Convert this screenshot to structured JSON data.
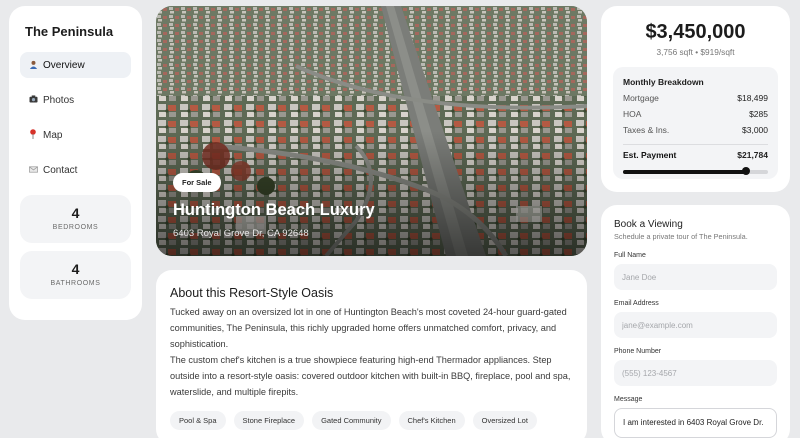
{
  "sidebar": {
    "brand": "The Peninsula",
    "nav": [
      {
        "label": "Overview",
        "icon": "person-icon"
      },
      {
        "label": "Photos",
        "icon": "camera-icon"
      },
      {
        "label": "Map",
        "icon": "pin-icon"
      },
      {
        "label": "Contact",
        "icon": "mail-icon"
      }
    ],
    "stats": [
      {
        "value": "4",
        "label": "BEDROOMS"
      },
      {
        "value": "4",
        "label": "BATHROOMS"
      }
    ]
  },
  "hero": {
    "badge": "For Sale",
    "title": "Huntington Beach Luxury",
    "address": "6403 Royal Grove Dr, CA 92648"
  },
  "about": {
    "title": "About this Resort-Style Oasis",
    "paragraphs": [
      "Tucked away on an oversized lot in one of Huntington Beach's most coveted 24-hour guard-gated communities, The Peninsula, this richly upgraded home offers unmatched comfort, privacy, and sophistication.",
      "The custom chef's kitchen is a true showpiece featuring high-end Thermador appliances. Step outside into a resort-style oasis: covered outdoor kitchen with built-in BBQ, fireplace, pool and spa, waterslide, and multiple firepits."
    ],
    "tags": [
      "Pool & Spa",
      "Stone Fireplace",
      "Gated Community",
      "Chef's Kitchen",
      "Oversized Lot"
    ]
  },
  "price": {
    "amount": "$3,450,000",
    "sub": "3,756 sqft • $919/sqft",
    "breakdown": {
      "title": "Monthly Breakdown",
      "rows": [
        {
          "label": "Mortgage",
          "value": "$18,499"
        },
        {
          "label": "HOA",
          "value": "$285"
        },
        {
          "label": "Taxes & Ins.",
          "value": "$3,000"
        }
      ],
      "total_label": "Est. Payment",
      "total_value": "$21,784",
      "slider_fraction": 0.85
    }
  },
  "booking": {
    "title": "Book a Viewing",
    "subtitle": "Schedule a private tour of The Peninsula.",
    "fields": [
      {
        "label": "Full Name",
        "placeholder": "Jane Doe"
      },
      {
        "label": "Email Address",
        "placeholder": "jane@example.com"
      },
      {
        "label": "Phone Number",
        "placeholder": "(555) 123-4567"
      }
    ],
    "message_label": "Message",
    "message_value": "I am interested in 6403 Royal Grove Dr."
  }
}
